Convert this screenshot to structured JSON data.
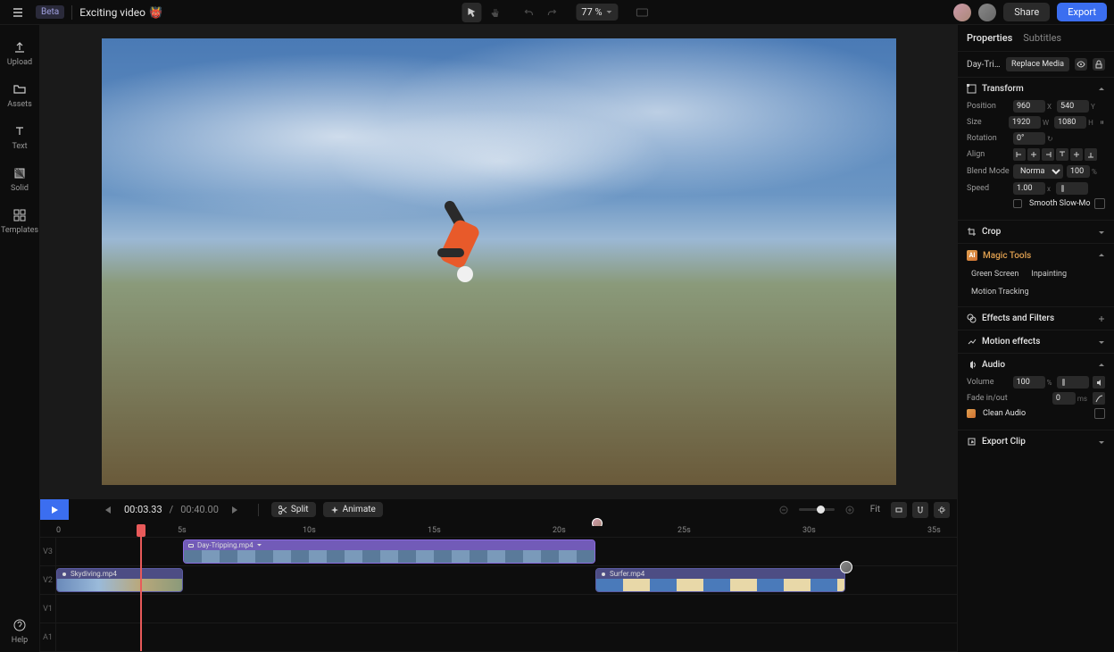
{
  "topbar": {
    "beta": "Beta",
    "project": "Exciting video",
    "emoji": "👹",
    "zoom": "77 %",
    "share": "Share",
    "export": "Export"
  },
  "sidebar": {
    "items": [
      {
        "label": "Upload"
      },
      {
        "label": "Assets"
      },
      {
        "label": "Text"
      },
      {
        "label": "Solid"
      },
      {
        "label": "Templates"
      }
    ],
    "help": "Help"
  },
  "transport": {
    "current": "00:03.33",
    "sep": "/",
    "total": "00:40.00",
    "split": "Split",
    "animate": "Animate",
    "fit": "Fit"
  },
  "ruler": {
    "ticks": [
      "0",
      "5s",
      "10s",
      "15s",
      "20s",
      "25s",
      "30s",
      "35s"
    ]
  },
  "tracks": {
    "labels": [
      "V3",
      "V2",
      "V1",
      "A1"
    ],
    "clips": {
      "v3": {
        "name": "Day-Tripping.mp4"
      },
      "v2a": {
        "name": "Skydiving.mp4"
      },
      "v2b": {
        "name": "Surfer.mp4"
      }
    }
  },
  "panel": {
    "tabs": {
      "properties": "Properties",
      "subtitles": "Subtitles"
    },
    "media": {
      "name": "Day-Trip…",
      "replace": "Replace Media"
    },
    "transform": {
      "title": "Transform",
      "position": {
        "label": "Position",
        "x": "960",
        "y": "540"
      },
      "size": {
        "label": "Size",
        "w": "1920",
        "h": "1080"
      },
      "rotation": {
        "label": "Rotation",
        "v": "0°"
      },
      "align": {
        "label": "Align"
      },
      "blend": {
        "label": "Blend Mode",
        "v": "Normal",
        "opacity": "100"
      },
      "speed": {
        "label": "Speed",
        "v": "1.00"
      },
      "smooth": "Smooth Slow-Mo"
    },
    "crop": {
      "title": "Crop"
    },
    "magic": {
      "title": "Magic Tools",
      "tools": [
        "Green Screen",
        "Inpainting",
        "Motion Tracking"
      ]
    },
    "effects": {
      "title": "Effects and Filters"
    },
    "motion": {
      "title": "Motion effects"
    },
    "audio": {
      "title": "Audio",
      "volume": {
        "label": "Volume",
        "v": "100"
      },
      "fade": {
        "label": "Fade in/out",
        "v": "0",
        "unit": "ms"
      },
      "clean": "Clean Audio"
    },
    "exportclip": {
      "title": "Export Clip"
    }
  }
}
